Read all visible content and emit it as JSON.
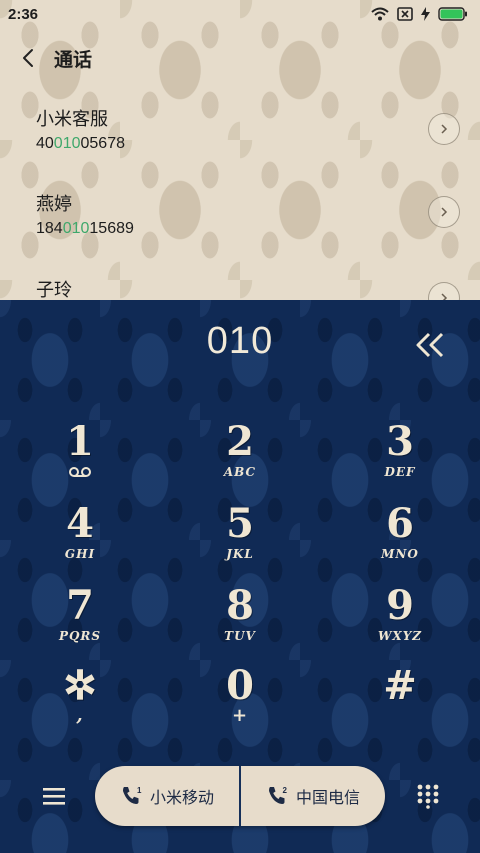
{
  "status_bar": {
    "time": "2:36",
    "icons": [
      "wifi-icon",
      "no-sim-icon",
      "charging-icon",
      "battery-icon"
    ]
  },
  "header": {
    "title": "通话",
    "back_icon": "chevron-left-icon"
  },
  "contacts": [
    {
      "name": "小米客服",
      "number_pre": "40",
      "number_match": "010",
      "number_post": "05678"
    },
    {
      "name": "燕婷",
      "number_pre": "184",
      "number_match": "010",
      "number_post": "15689"
    },
    {
      "name": "子玲",
      "number_pre": "",
      "number_match": "",
      "number_post": ""
    }
  ],
  "dialer": {
    "input": "010",
    "delete_icon": "double-chevron-left-icon",
    "keys": [
      {
        "digit": "1",
        "letters": ""
      },
      {
        "digit": "2",
        "letters": "ABC"
      },
      {
        "digit": "3",
        "letters": "DEF"
      },
      {
        "digit": "4",
        "letters": "GHI"
      },
      {
        "digit": "5",
        "letters": "JKL"
      },
      {
        "digit": "6",
        "letters": "MNO"
      },
      {
        "digit": "7",
        "letters": "PQRS"
      },
      {
        "digit": "8",
        "letters": "TUV"
      },
      {
        "digit": "9",
        "letters": "WXYZ"
      },
      {
        "digit": "✲",
        "letters": ","
      },
      {
        "digit": "0",
        "letters": "+"
      },
      {
        "digit": "#",
        "letters": ""
      }
    ]
  },
  "bottom_bar": {
    "sim1_label": "小米移动",
    "sim2_label": "中国电信",
    "menu_icon": "hamburger-menu-icon",
    "keypad_icon": "keypad-icon"
  },
  "colors": {
    "top_background": "#e6dccb",
    "dialpad_background": "#102a55",
    "match_highlight": "#3fa86b",
    "key_text": "#efe6d3",
    "call_button_bg": "#e7dccb"
  }
}
